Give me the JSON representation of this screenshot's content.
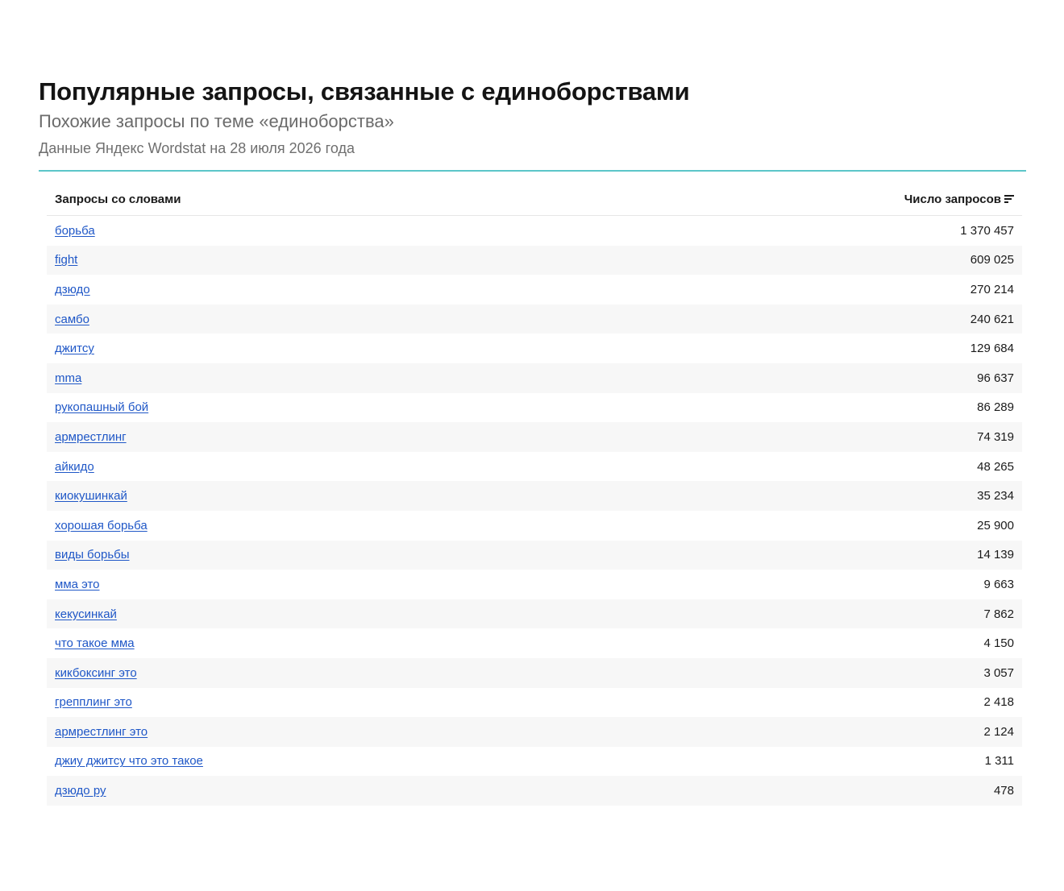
{
  "header": {
    "title": "Популярные запросы, связанные с единоборствами",
    "subtitle": "Похожие запросы по теме «единоборства»",
    "meta": "Данные Яндекс Wordstat на 28 июля 2026 года"
  },
  "table": {
    "columns": {
      "query": "Запросы со словами",
      "count": "Число запросов"
    },
    "rows": [
      {
        "query": "борьба",
        "count": "1 370 457"
      },
      {
        "query": "fight",
        "count": "609 025"
      },
      {
        "query": "дзюдо",
        "count": "270 214"
      },
      {
        "query": "самбо",
        "count": "240 621"
      },
      {
        "query": "джитсу",
        "count": "129 684"
      },
      {
        "query": "mma",
        "count": "96 637"
      },
      {
        "query": "рукопашный бой",
        "count": "86 289"
      },
      {
        "query": "армрестлинг",
        "count": "74 319"
      },
      {
        "query": "айкидо",
        "count": "48 265"
      },
      {
        "query": "киокушинкай",
        "count": "35 234"
      },
      {
        "query": "хорошая борьба",
        "count": "25 900"
      },
      {
        "query": "виды борьбы",
        "count": "14 139"
      },
      {
        "query": "мма это",
        "count": "9 663"
      },
      {
        "query": "кекусинкай",
        "count": "7 862"
      },
      {
        "query": "что такое мма",
        "count": "4 150"
      },
      {
        "query": "кикбоксинг это",
        "count": "3 057"
      },
      {
        "query": "грепплинг это",
        "count": "2 418"
      },
      {
        "query": "армрестлинг это",
        "count": "2 124"
      },
      {
        "query": "джиу джитсу что это такое",
        "count": "1 311"
      },
      {
        "query": "дзюдо ру",
        "count": "478"
      }
    ]
  },
  "icons": {
    "sort": "sort-descending-icon"
  },
  "colors": {
    "link": "#1f57c7",
    "divider": "#5cc6c9",
    "row_stripe": "#f7f7f7"
  }
}
